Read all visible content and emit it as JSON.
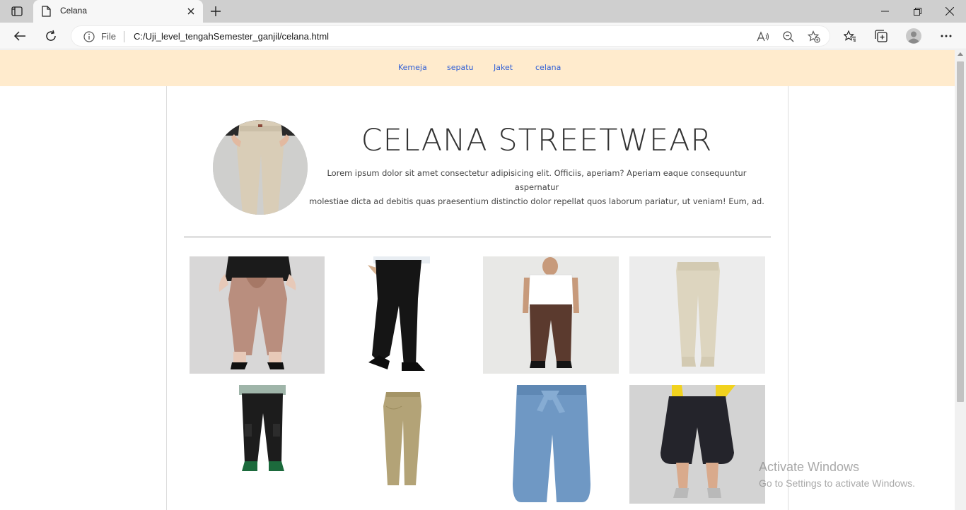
{
  "browser": {
    "tab_title": "Celana",
    "address": {
      "info_label": "File",
      "url": "C:/Uji_level_tengahSemester_ganjil/celana.html"
    }
  },
  "site": {
    "nav": [
      "Kemeja",
      "sepatu",
      "Jaket",
      "celana"
    ],
    "hero": {
      "title": "CELANA STREETWEAR",
      "description_line1": "Lorem ipsum dolor sit amet consectetur adipisicing elit. Officiis, aperiam? Aperiam eaque consequuntur aspernatur",
      "description_line2": "molestiae dicta ad debitis quas praesentium distinctio dolor repellat quos laborum pariatur, ut veniam! Eum, ad."
    },
    "products": [
      {
        "name": "product-image-pink-tie-waist-pants",
        "colors": {
          "bg": "#d8d7d7",
          "pants": "#b98e7e",
          "top": "#1b1b1b",
          "skin": "#e7c9b8"
        }
      },
      {
        "name": "product-image-black-dress-pants",
        "colors": {
          "bg": "#ffffff",
          "pants": "#151515",
          "top": "#e8edf2",
          "skin": "#d5b08f"
        }
      },
      {
        "name": "product-image-brown-chinos-back",
        "colors": {
          "bg": "#e8e8e6",
          "pants": "#5b3a2e",
          "top": "#ffffff",
          "skin": "#c79a7b"
        }
      },
      {
        "name": "product-image-cream-joggers",
        "colors": {
          "bg": "#ececec",
          "pants": "#ddd5bf",
          "top": "#ececec",
          "skin": "#ececec"
        }
      },
      {
        "name": "product-image-black-cargo-pants",
        "colors": {
          "bg": "#ffffff",
          "pants": "#1c1c1c",
          "top": "#9fb5a9",
          "skin": "#c7a384"
        }
      },
      {
        "name": "product-image-khaki-pants",
        "colors": {
          "bg": "#ffffff",
          "pants": "#b3a377",
          "top": "#ffffff",
          "skin": "#ffffff"
        }
      },
      {
        "name": "product-image-denim-culottes",
        "colors": {
          "bg": "#ffffff",
          "pants": "#6f98c4",
          "top": "#ffffff",
          "skin": "#ffffff"
        }
      },
      {
        "name": "product-image-black-floral-culottes",
        "colors": {
          "bg": "#d3d3d3",
          "pants": "#24242b",
          "top": "#f1d21e",
          "skin": "#d9aa8c"
        }
      }
    ]
  },
  "system": {
    "watermark_title": "Activate Windows",
    "watermark_subtitle": "Go to Settings to activate Windows."
  }
}
